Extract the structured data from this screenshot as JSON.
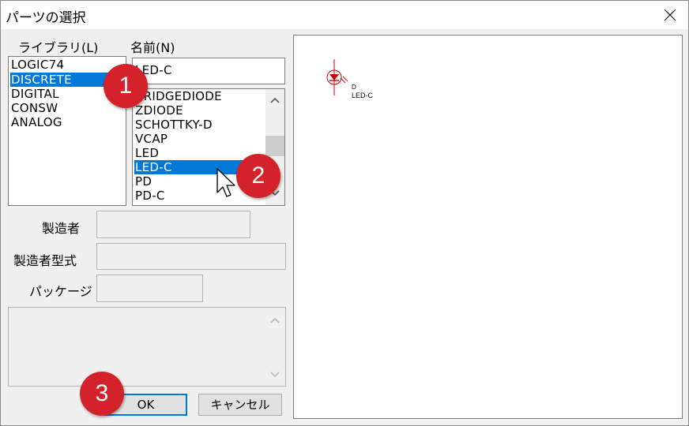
{
  "window": {
    "title": "パーツの選択"
  },
  "library": {
    "label": "ライブラリ(L)",
    "items": [
      "LOGIC74",
      "DISCRETE",
      "DIGITAL",
      "CONSW",
      "ANALOG"
    ],
    "selected": "DISCRETE"
  },
  "name": {
    "label": "名前(N)",
    "value": "LED-C",
    "items": [
      "BRIDGEDIODE",
      "ZDIODE",
      "SCHOTTKY-D",
      "VCAP",
      "LED",
      "LED-C",
      "PD",
      "PD-C"
    ],
    "selected": "LED-C"
  },
  "fields": {
    "maker_label": "製造者",
    "maker_value": "",
    "model_label": "製造者型式",
    "model_value": "",
    "package_label": "パッケージ",
    "package_value": ""
  },
  "buttons": {
    "ok": "OK",
    "cancel": "キャンセル"
  },
  "preview": {
    "ref_label": "D",
    "part_label": "LED-C"
  },
  "badges": [
    "1",
    "2",
    "3"
  ],
  "colors": {
    "selection": "#0078d7",
    "badge": "#d4222a",
    "symbol": "#cc0000"
  }
}
